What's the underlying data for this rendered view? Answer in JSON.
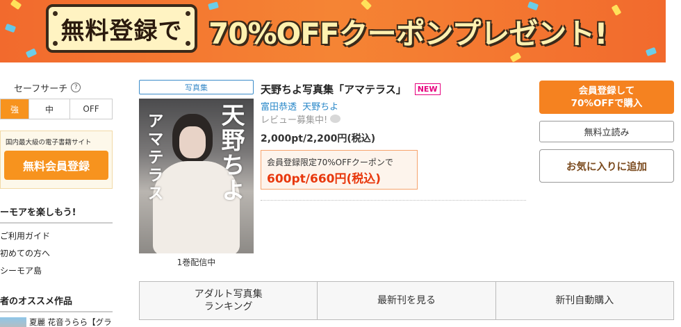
{
  "banner": {
    "badge_text": "無料登録で",
    "headline": "70%OFFクーポンプレゼント!"
  },
  "sidebar": {
    "safe_search": {
      "title": "セーフサーチ",
      "help_icon": "?",
      "options": [
        "強",
        "中",
        "OFF"
      ],
      "active": "強"
    },
    "register": {
      "tagline": "国内最大級の電子書籍サイト",
      "button": "無料会員登録"
    },
    "section_title": "ーモアを楽しもう!",
    "links": [
      "ご利用ガイド",
      "初めての方へ",
      "シーモア島"
    ],
    "recommend_title": "者のオススメ作品",
    "recommend_item": "夏麗 花音うらら【グラビア写真集】"
  },
  "product": {
    "category": "写真集",
    "cover": {
      "name_vertical": "天野ちよ",
      "subtitle_vertical": "アマテラス"
    },
    "volumes": "1巻配信中",
    "title": "天野ちよ写真集「アマテラス」",
    "new_badge": "NEW",
    "authors": [
      "富田恭透",
      "天野ちよ"
    ],
    "review": "レビュー募集中!",
    "price": "2,000pt/2,200円(税込)",
    "coupon_label": "会員登録限定70%OFFクーポンで",
    "coupon_price": "600pt/660円(税込)"
  },
  "actions": {
    "buy_line1": "会員登録して",
    "buy_line2": "70%OFFで購入",
    "free_read": "無料立読み",
    "favorite": "お気に入りに追加"
  },
  "bottom": {
    "buttons": [
      "アダルト写真集\nランキング",
      "最新刊を見る",
      "新刊自動購入"
    ]
  },
  "colors": {
    "accent_orange": "#f58220",
    "link_blue": "#2a88c9",
    "new_pink": "#e6007e",
    "coupon_red": "#e8380d"
  }
}
